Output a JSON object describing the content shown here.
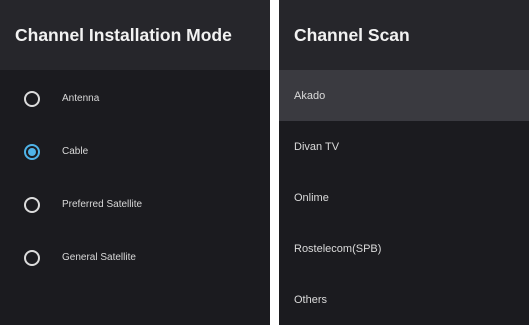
{
  "install_mode_panel": {
    "title": "Channel Installation Mode",
    "options": [
      {
        "label": "Antenna",
        "selected": false
      },
      {
        "label": "Cable",
        "selected": true
      },
      {
        "label": "Preferred Satellite",
        "selected": false
      },
      {
        "label": "General Satellite",
        "selected": false
      }
    ]
  },
  "channel_scan_panel": {
    "title": "Channel Scan",
    "operators": [
      {
        "label": "Akado",
        "focused": true
      },
      {
        "label": "Divan TV",
        "focused": false
      },
      {
        "label": "Onlime",
        "focused": false
      },
      {
        "label": "Rostelecom(SPB)",
        "focused": false
      },
      {
        "label": "Others",
        "focused": false
      }
    ]
  },
  "colors": {
    "panel_bg": "#1b1b1f",
    "header_bg": "#26262b",
    "focus_bg": "#3a3a40",
    "radio_accent": "#4fb3e8"
  }
}
